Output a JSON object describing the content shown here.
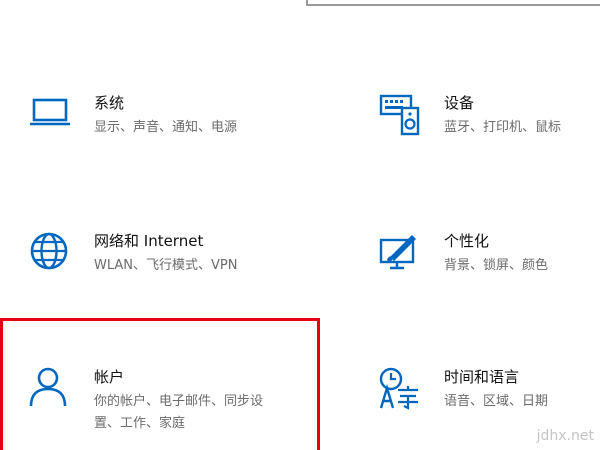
{
  "settings": {
    "accent_color": "#0067c0",
    "tiles": [
      {
        "title": "系统",
        "desc": "显示、声音、通知、电源",
        "icon": "laptop-icon"
      },
      {
        "title": "设备",
        "desc": "蓝牙、打印机、鼠标",
        "icon": "devices-icon"
      },
      {
        "title": "网络和 Internet",
        "desc": "WLAN、飞行模式、VPN",
        "icon": "globe-icon"
      },
      {
        "title": "个性化",
        "desc": "背景、锁屏、颜色",
        "icon": "paint-brush-icon"
      },
      {
        "title": "帐户",
        "desc_line1": "你的帐户、电子邮件、同步设",
        "desc_line2": "置、工作、家庭",
        "icon": "person-icon"
      },
      {
        "title": "时间和语言",
        "desc": "语音、区域、日期",
        "icon": "time-language-icon"
      }
    ]
  },
  "highlight": {
    "color": "#e60012"
  },
  "watermark": {
    "text": "jdhx.net"
  }
}
